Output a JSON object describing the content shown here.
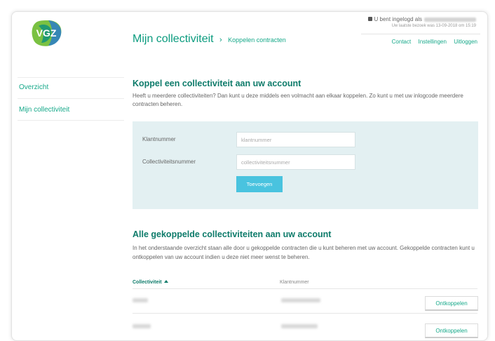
{
  "logo": {
    "text": "VGZ",
    "colors": {
      "green": "#7ac142",
      "teal": "#0a8f7e",
      "blue": "#2a7cc9"
    }
  },
  "header": {
    "title": "Mijn collectiviteit",
    "separator": "›",
    "breadcrumb": "Koppelen contracten",
    "login_text": "U bent ingelogd als",
    "last_visit": "Uw laatste bezoek was 13-09-2018 om 15:19",
    "links": [
      "Contact",
      "Instellingen",
      "Uitloggen"
    ]
  },
  "sidebar": {
    "items": [
      {
        "label": "Overzicht"
      },
      {
        "label": "Mijn collectiviteit"
      }
    ]
  },
  "koppel": {
    "title": "Koppel een collectiviteit aan uw account",
    "intro": "Heeft u meerdere collectiviteiten? Dan kunt u deze middels een volmacht aan elkaar koppelen. Zo kunt u met uw inlogcode meerdere contracten beheren.",
    "form": {
      "klantnummer_label": "Klantnummer",
      "klantnummer_placeholder": "klantnummer",
      "collectiviteit_label": "Collectiviteitsnummer",
      "collectiviteit_placeholder": "collectiviteitsnummer",
      "add_button": "Toevoegen"
    }
  },
  "gekoppeld": {
    "title": "Alle gekoppelde collectiviteiten aan uw account",
    "intro": "In het onderstaande overzicht staan alle door u gekoppelde contracten die u kunt beheren met uw account. Gekoppelde contracten kunt u ontkoppelen van uw account indien u deze niet meer wenst te beheren.",
    "columns": [
      "Collectiviteit",
      "Klantnummer"
    ],
    "rows": [
      {
        "action": "Ontkoppelen"
      },
      {
        "action": "Ontkoppelen"
      }
    ]
  },
  "colors": {
    "accent": "#17a98a",
    "heading": "#0d7b6a",
    "button": "#49c3df",
    "panel": "#e3f0f2"
  }
}
